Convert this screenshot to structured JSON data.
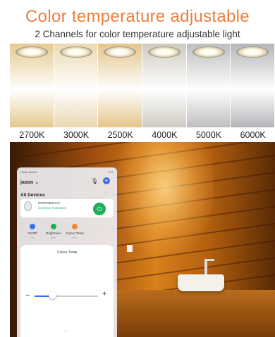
{
  "header": {
    "title": "Color temperature adjustable",
    "subtitle": "2 Channels for color temperature adjustable light"
  },
  "swatches": [
    {
      "label": "2700K",
      "color": "#e6c98f"
    },
    {
      "label": "3000K",
      "color": "#ead8b2"
    },
    {
      "label": "2500K",
      "color": "#e4c48a"
    },
    {
      "label": "4000K",
      "color": "#cfcbc1"
    },
    {
      "label": "5000K",
      "color": "#bebebe"
    },
    {
      "label": "6000K",
      "color": "#b3b5b8"
    }
  ],
  "app": {
    "status_left": "China Mobile",
    "status_right": "9:41",
    "user": "jason ⌄",
    "mic_icon": "microphone-icon",
    "add_icon": "plus-icon",
    "all_devices": "All Devices",
    "more": "···",
    "device_name": "IPD(RGB/CCT)",
    "common_functions": "Common Functions ›",
    "controls": [
      {
        "label": "On/Off",
        "sub": "ON",
        "color": "#3b6ff0"
      },
      {
        "label": "Brightness",
        "sub": "50%",
        "color": "#1fae5b"
      },
      {
        "label": "Colour Temp",
        "sub": "50%",
        "color": "#f08a3b"
      }
    ],
    "sheet": {
      "title": "Colour Temp",
      "minus": "−",
      "plus": "+",
      "slider_value": 0.28,
      "chevron": "⌄"
    },
    "accent": "#3b6ff0",
    "power_color": "#1fae5b"
  }
}
